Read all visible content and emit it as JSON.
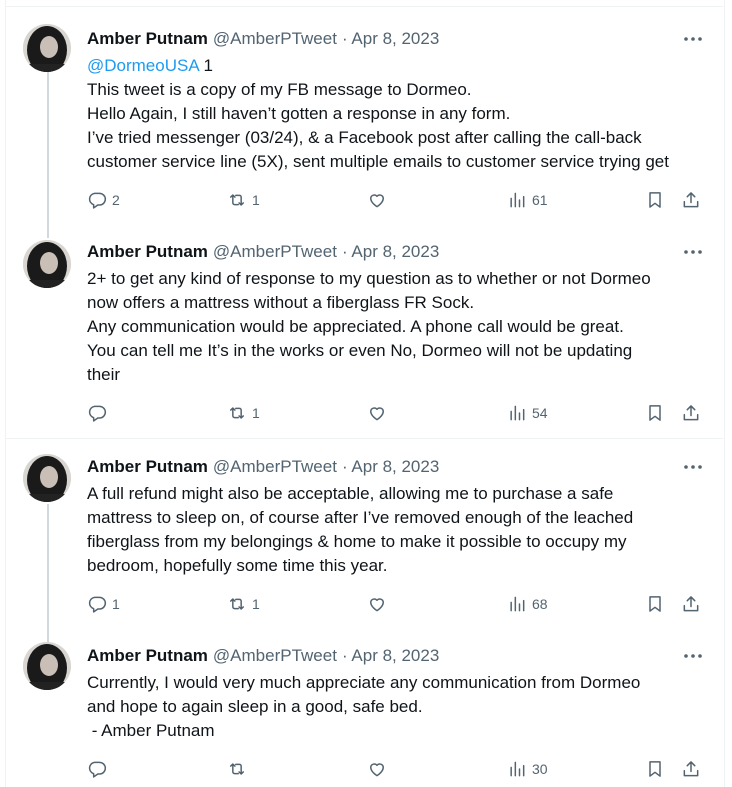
{
  "tweets": [
    {
      "author": {
        "name": "Amber Putnam",
        "handle": "@AmberPTweet",
        "date": "· Apr 8, 2023"
      },
      "mention": "@DormeoUSA",
      "mention_suffix": " 1",
      "lines": [
        "This tweet is a copy of my FB message to Dormeo.",
        "Hello Again, I still haven’t gotten a response in any form.",
        "I’ve tried messenger (03/24), & a Facebook post after calling the call-back",
        "customer service line (5X), sent multiple emails to customer service trying get"
      ],
      "stats": {
        "replies": "2",
        "retweets": "1",
        "likes": "",
        "views": "61"
      }
    },
    {
      "author": {
        "name": "Amber Putnam",
        "handle": "@AmberPTweet",
        "date": "· Apr 8, 2023"
      },
      "lines": [
        "2+ to get any kind of response to my question as to whether or not Dormeo",
        "now offers a mattress without a fiberglass FR Sock.",
        "Any communication would be appreciated. A phone call would be great.",
        "You can tell me It’s in the works or even No, Dormeo will not be updating",
        "their"
      ],
      "stats": {
        "replies": "",
        "retweets": "1",
        "likes": "",
        "views": "54"
      }
    },
    {
      "author": {
        "name": "Amber Putnam",
        "handle": "@AmberPTweet",
        "date": "· Apr 8, 2023"
      },
      "lines": [
        "A full refund might also be acceptable, allowing me to purchase a safe",
        "mattress to sleep on, of course after I’ve removed enough of the leached",
        "fiberglass from my belongings & home to make it possible to occupy my",
        "bedroom, hopefully some time this year."
      ],
      "stats": {
        "replies": "1",
        "retweets": "1",
        "likes": "",
        "views": "68"
      }
    },
    {
      "author": {
        "name": "Amber Putnam",
        "handle": "@AmberPTweet",
        "date": "· Apr 8, 2023"
      },
      "lines": [
        "Currently, I would very much appreciate any communication from Dormeo",
        "and hope to again sleep in a good, safe bed.",
        " - Amber Putnam"
      ],
      "stats": {
        "replies": "",
        "retweets": "",
        "likes": "",
        "views": "30"
      }
    }
  ],
  "icons": {
    "reply": "reply-icon",
    "retweet": "retweet-icon",
    "like": "heart-icon",
    "views": "views-icon",
    "bookmark": "bookmark-icon",
    "share": "share-icon",
    "more": "more-icon"
  },
  "colors": {
    "text": "#0f1419",
    "secondary": "#536471",
    "link": "#1d9bf0",
    "border": "#eff3f4"
  }
}
